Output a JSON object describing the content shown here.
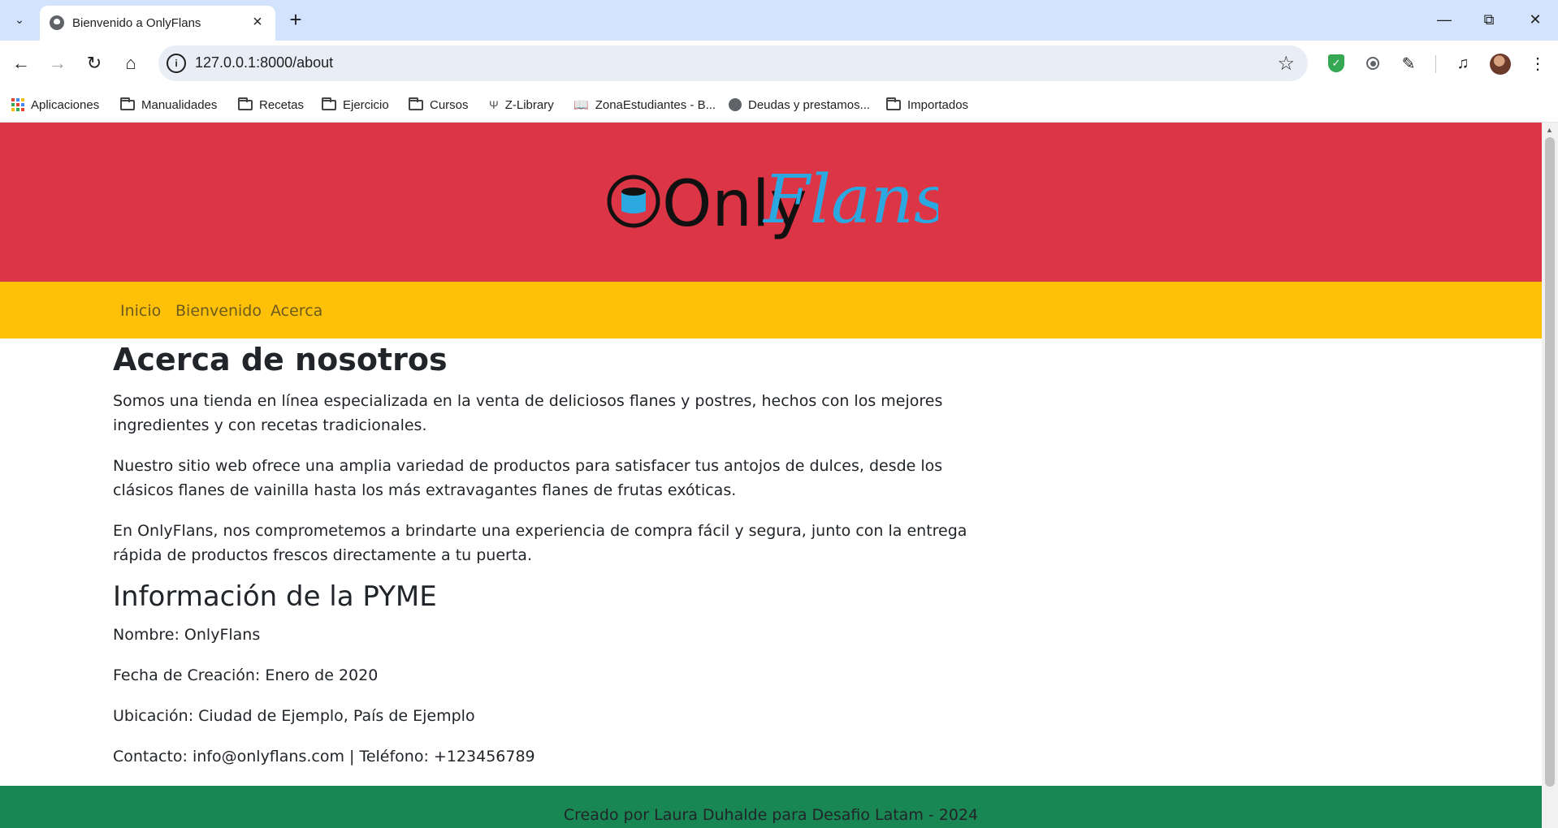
{
  "browser": {
    "tab_title": "Bienvenido a OnlyFlans",
    "url": "127.0.0.1:8000/about",
    "bookmarks": [
      "Aplicaciones",
      "Manualidades",
      "Recetas",
      "Ejercicio",
      "Cursos",
      "Z-Library",
      "ZonaEstudiantes - B...",
      "Deudas y prestamos...",
      "Importados"
    ]
  },
  "site": {
    "logo_part1": "Only",
    "logo_part2": "Flans",
    "nav": [
      "Inicio",
      "Bienvenido",
      "Acerca"
    ],
    "title": "Acerca de nosotros",
    "paragraphs": [
      "Somos una tienda en línea especializada en la venta de deliciosos flanes y postres, hechos con los mejores ingredientes y con recetas tradicionales.",
      "Nuestro sitio web ofrece una amplia variedad de productos para satisfacer tus antojos de dulces, desde los clásicos flanes de vainilla hasta los más extravagantes flanes de frutas exóticas.",
      "En OnlyFlans, nos comprometemos a brindarte una experiencia de compra fácil y segura, junto con la entrega rápida de productos frescos directamente a tu puerta."
    ],
    "info_title": "Información de la PYME",
    "info": [
      "Nombre: OnlyFlans",
      "Fecha de Creación: Enero de 2020",
      "Ubicación: Ciudad de Ejemplo, País de Ejemplo",
      "Contacto: info@onlyflans.com | Teléfono: +123456789"
    ],
    "footer": "Creado por Laura Duhalde para Desafio Latam - 2024"
  },
  "colors": {
    "header": "#dc3545",
    "navbar": "#ffc107",
    "footer": "#198754",
    "logo_accent": "#2ca8e0"
  }
}
